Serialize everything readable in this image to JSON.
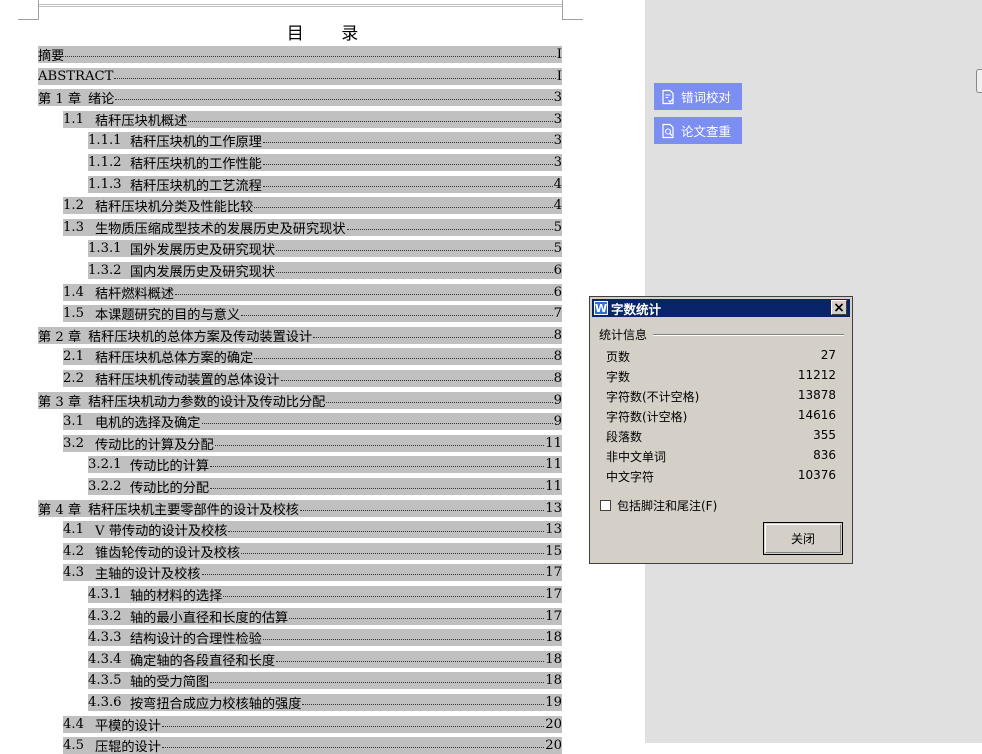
{
  "document": {
    "toc_title": "目 录",
    "toc": [
      {
        "num": "",
        "text": "摘要",
        "page": "I",
        "level": 0
      },
      {
        "num": "",
        "text": "ABSTRACT",
        "page": "I",
        "level": 0
      },
      {
        "num": "第 1 章",
        "text": "绪论",
        "page": "3",
        "level": 0
      },
      {
        "num": "1.1",
        "text": "秸秆压块机概述",
        "page": "3",
        "level": 1
      },
      {
        "num": "1.1.1",
        "text": "秸秆压块机的工作原理",
        "page": "3",
        "level": 2
      },
      {
        "num": "1.1.2",
        "text": "秸秆压块机的工作性能",
        "page": "3",
        "level": 2
      },
      {
        "num": "1.1.3",
        "text": "秸秆压块机的工艺流程",
        "page": "4",
        "level": 2
      },
      {
        "num": "1.2",
        "text": "秸秆压块机分类及性能比较",
        "page": "4",
        "level": 1
      },
      {
        "num": "1.3",
        "text": "生物质压缩成型技术的发展历史及研究现状",
        "page": "5",
        "level": 1
      },
      {
        "num": "1.3.1",
        "text": "国外发展历史及研究现状",
        "page": "5",
        "level": 2
      },
      {
        "num": "1.3.2",
        "text": "国内发展历史及研究现状",
        "page": "6",
        "level": 2
      },
      {
        "num": "1.4",
        "text": "秸杆燃料概述",
        "page": "6",
        "level": 1
      },
      {
        "num": "1.5",
        "text": "本课题研究的目的与意义",
        "page": "7",
        "level": 1
      },
      {
        "num": "第 2 章",
        "text": "秸秆压块机的总体方案及传动装置设计",
        "page": "8",
        "level": 0
      },
      {
        "num": "2.1",
        "text": "秸秆压块机总体方案的确定",
        "page": "8",
        "level": 1
      },
      {
        "num": "2.2",
        "text": "秸秆压块机传动装置的总体设计",
        "page": "8",
        "level": 1
      },
      {
        "num": "第 3 章",
        "text": "秸秆压块机动力参数的设计及传动比分配",
        "page": "9",
        "level": 0
      },
      {
        "num": "3.1",
        "text": "电机的选择及确定",
        "page": "9",
        "level": 1
      },
      {
        "num": "3.2",
        "text": "传动比的计算及分配",
        "page": "11",
        "level": 1
      },
      {
        "num": "3.2.1",
        "text": "传动比的计算",
        "page": "11",
        "level": 2
      },
      {
        "num": "3.2.2",
        "text": "传动比的分配",
        "page": "11",
        "level": 2
      },
      {
        "num": "第 4 章",
        "text": "秸秆压块机主要零部件的设计及校核",
        "page": "13",
        "level": 0
      },
      {
        "num": "4.1",
        "text": "V 带传动的设计及校核",
        "page": "13",
        "level": 1
      },
      {
        "num": "4.2",
        "text": "锥齿轮传动的设计及校核",
        "page": "15",
        "level": 1
      },
      {
        "num": "4.3",
        "text": "主轴的设计及校核",
        "page": "17",
        "level": 1
      },
      {
        "num": "4.3.1",
        "text": "轴的材料的选择",
        "page": "17",
        "level": 2
      },
      {
        "num": "4.3.2",
        "text": "轴的最小直径和长度的估算",
        "page": "17",
        "level": 2
      },
      {
        "num": "4.3.3",
        "text": "结构设计的合理性检验",
        "page": "18",
        "level": 2
      },
      {
        "num": "4.3.4",
        "text": "确定轴的各段直径和长度",
        "page": "18",
        "level": 2
      },
      {
        "num": "4.3.5",
        "text": "轴的受力简图",
        "page": "18",
        "level": 2
      },
      {
        "num": "4.3.6",
        "text": "按弯扭合成应力校核轴的强度",
        "page": "19",
        "level": 2
      },
      {
        "num": "4.4",
        "text": "平模的设计",
        "page": "20",
        "level": 1
      },
      {
        "num": "4.5",
        "text": "压辊的设计",
        "page": "20",
        "level": 1
      }
    ]
  },
  "side_buttons": [
    {
      "label": "错词校对",
      "icon": "proofread-icon"
    },
    {
      "label": "论文查重",
      "icon": "plagiarism-check-icon"
    }
  ],
  "dialog": {
    "title": "字数统计",
    "group_label": "统计信息",
    "stats": [
      {
        "label": "页数",
        "value": "27"
      },
      {
        "label": "字数",
        "value": "11212"
      },
      {
        "label": "字符数(不计空格)",
        "value": "13878"
      },
      {
        "label": "字符数(计空格)",
        "value": "14616"
      },
      {
        "label": "段落数",
        "value": "355"
      },
      {
        "label": "非中文单词",
        "value": "836"
      },
      {
        "label": "中文字符",
        "value": "10376"
      }
    ],
    "checkbox_label": "包括脚注和尾注(F)",
    "checkbox_checked": false,
    "close_label": "关闭"
  },
  "colors": {
    "highlight": "#c0c0c0",
    "side_button": "#7d8ef3",
    "titlebar": "#0a246a",
    "dialog_bg": "#d4d0c8",
    "workspace": "#e0e0e0"
  }
}
